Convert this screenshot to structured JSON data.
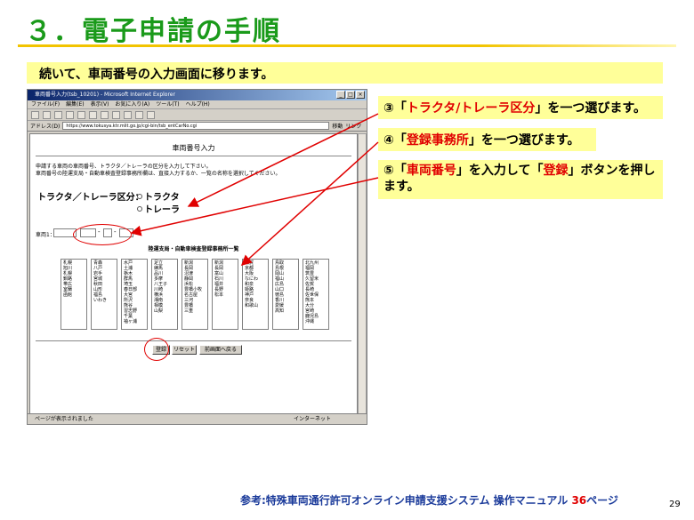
{
  "slide": {
    "title": "３．電子申請の手順",
    "subtitle": "続いて、車両番号の入力画面に移ります。",
    "notes": {
      "n3_prefix": "③「",
      "n3_hl": "トラクタ/トレーラ区分",
      "n3_suffix": "」を一つ選びます。",
      "n4_prefix": "④「",
      "n4_hl": "登録事務所",
      "n4_suffix": "」を一つ選びます。",
      "n5_prefix": "⑤「",
      "n5_hl1": "車両番号",
      "n5_mid": "」を入力して「",
      "n5_hl2": "登録",
      "n5_suffix": "」ボタンを押します。"
    },
    "footer_prefix": "参考:特殊車両通行許可オンライン申請支援システム 操作マニュアル ",
    "footer_num": "36",
    "footer_suffix": "ページ",
    "page_number": "29"
  },
  "browser": {
    "title": "車両番号入力(tsb_10201) - Microsoft Internet Explorer",
    "menu": [
      "ファイル(F)",
      "編集(E)",
      "表示(V)",
      "お気に入り(A)",
      "ツール(T)",
      "ヘルプ(H)"
    ],
    "address_label": "アドレス(D)",
    "address": "https://www.tokusya.ktr.mlit.go.jp/cgi-bin/tsb_entCarNo.cgi",
    "go": "移動",
    "links": "リンク",
    "status_left": "ページが表示されました",
    "status_right": "インターネット"
  },
  "form": {
    "heading": "車両番号入力",
    "desc1": "申請する車両の車両番号、トラクタ／トレーラの区分を入力して下さい。",
    "desc2": "車両番号の陸運支局・自動車検査登録事務所欄は、直接入力するか、一覧の名称を選択してください。",
    "category_label": "トラクタ／トレーラ区分：",
    "radio1": "トラクタ",
    "radio2": "トレーラ",
    "plate_label": "車両1：",
    "office_list_title": "陸運支局・自動車検査登録事務所一覧",
    "office_columns": [
      [
        "札幌",
        "旭川",
        "札幌",
        "釧路",
        "帯広",
        "室蘭",
        "函館"
      ],
      [
        "青森",
        "八戸",
        "岩手",
        "宮城",
        "秋田",
        "山形",
        "福島",
        "いわき"
      ],
      [
        "水戸",
        "土浦",
        "栃木",
        "群馬",
        "埼玉",
        "春日部",
        "大宮",
        "所沢",
        "熊谷",
        "習志野",
        "千葉",
        "袖ヶ浦"
      ],
      [
        "足立",
        "練馬",
        "品川",
        "多摩",
        "八王子",
        "川崎",
        "横浜",
        "湘南",
        "相模",
        "山梨"
      ],
      [
        "新潟",
        "長岡",
        "沼津",
        "静岡",
        "浜松",
        "豊橋小牧",
        "名古屋",
        "三河",
        "豊橋",
        "三重"
      ],
      [
        "新潟",
        "長岡",
        "富山",
        "石川",
        "福井",
        "長野",
        "松本"
      ],
      [
        "滋賀",
        "京都",
        "大阪",
        "なにわ",
        "和泉",
        "姫路",
        "神戸",
        "奈良",
        "和歌山"
      ],
      [
        "鳥取",
        "島根",
        "岡山",
        "福山",
        "広島",
        "山口",
        "徳島",
        "香川",
        "愛媛",
        "高知"
      ],
      [
        "北九州",
        "福岡",
        "筑豊",
        "久留米",
        "佐賀",
        "長崎",
        "佐世保",
        "熊本",
        "大分",
        "宮崎",
        "鹿児島",
        "沖縄"
      ]
    ],
    "btn_register": "登録",
    "btn_reset": "リセット",
    "btn_back": "前画面へ戻る"
  }
}
